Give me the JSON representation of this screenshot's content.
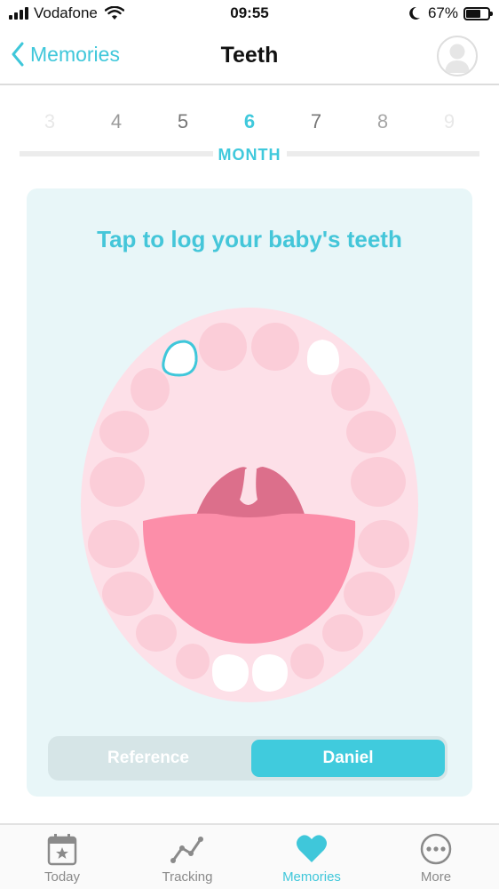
{
  "status_bar": {
    "carrier": "Vodafone",
    "time": "09:55",
    "battery": "67%",
    "battery_level": 0.67
  },
  "nav": {
    "back_label": "Memories",
    "title": "Teeth"
  },
  "month_picker": {
    "months": [
      "3",
      "4",
      "5",
      "6",
      "7",
      "8",
      "9"
    ],
    "selected": "6",
    "label": "MONTH"
  },
  "card": {
    "title": "Tap to log your baby's teeth",
    "logged_teeth": [
      "upper-left-central-selected",
      "upper-right-central",
      "lower-central-left",
      "lower-central-right"
    ]
  },
  "segmented": {
    "reference_label": "Reference",
    "daniel_label": "Daniel",
    "selected": "Daniel"
  },
  "tab_bar": {
    "items": [
      {
        "label": "Today",
        "icon": "calendar-star-icon"
      },
      {
        "label": "Tracking",
        "icon": "trend-line-icon"
      },
      {
        "label": "Memories",
        "icon": "heart-icon"
      },
      {
        "label": "More",
        "icon": "more-dots-icon"
      }
    ],
    "active": "Memories"
  },
  "colors": {
    "accent": "#40c9dc",
    "card_bg": "#e8f6f8",
    "gum": "#fde0e8",
    "tooth_placeholder": "#fbcdd8",
    "tongue": "#fc8ea9",
    "palate": "#dc6f8b"
  }
}
